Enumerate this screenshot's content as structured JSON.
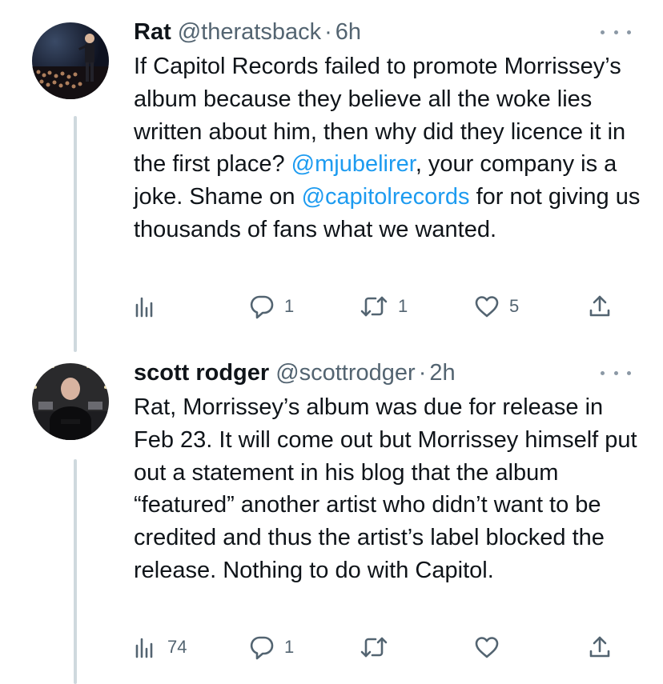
{
  "tweets": [
    {
      "name": "Rat",
      "handle": "@theratsback",
      "separator": "·",
      "time": "6h",
      "text_segments": [
        {
          "text": "If Capitol Records failed to promote Morrissey’s album because they believe all the woke lies written about him, then why did they licence it in the first place? ",
          "type": "text"
        },
        {
          "text": "@mjubelirer",
          "type": "mention"
        },
        {
          "text": ", your company is a joke. Shame on ",
          "type": "text"
        },
        {
          "text": "@capitolrecords",
          "type": "mention"
        },
        {
          "text": " for not giving us thousands of fans what we wanted.",
          "type": "text"
        }
      ],
      "actions": {
        "views": "",
        "replies": "1",
        "retweets": "1",
        "likes": "5"
      }
    },
    {
      "name": "scott rodger",
      "handle": "@scottrodger",
      "separator": "·",
      "time": "2h",
      "text_segments": [
        {
          "text": "Rat, Morrissey’s album was due for release in Feb 23. It will come out but Morrissey himself put out a statement in his blog that the album “featured” another artist who didn’t want to be credited and thus the artist’s label blocked the release. Nothing to do with Capitol.",
          "type": "text"
        }
      ],
      "actions": {
        "views": "74",
        "replies": "1",
        "retweets": "",
        "likes": ""
      }
    }
  ],
  "icons": {
    "views": "analytics-icon",
    "reply": "reply-icon",
    "retweet": "retweet-icon",
    "like": "heart-icon",
    "share": "share-icon",
    "more": "more-icon"
  },
  "colors": {
    "link": "#1d9bf0",
    "secondary_text": "#536471",
    "thread_line": "#cfd9de"
  }
}
